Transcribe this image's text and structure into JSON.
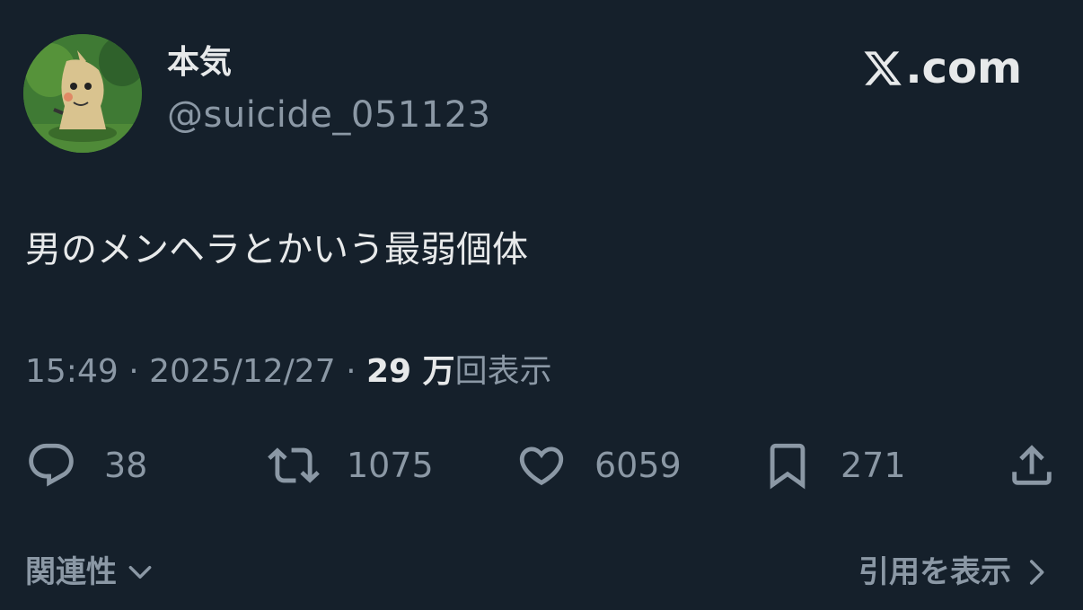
{
  "author": {
    "display_name": "本気",
    "handle": "@suicide_051123",
    "avatar_icon": "mimikyu-avatar-icon"
  },
  "brand": {
    "domain": ".com",
    "logo_icon": "x-logo-icon"
  },
  "tweet": {
    "text": "男のメンヘラとかいう最弱個体",
    "time": "15:49",
    "separator": "·",
    "date": "2025/12/27",
    "views_count": "29 万",
    "views_label": "回表示"
  },
  "actions": {
    "replies": {
      "icon": "reply-icon",
      "count": "38"
    },
    "retweets": {
      "icon": "retweet-icon",
      "count": "1075"
    },
    "likes": {
      "icon": "heart-icon",
      "count": "6059"
    },
    "bookmarks": {
      "icon": "bookmark-icon",
      "count": "271"
    },
    "share": {
      "icon": "share-icon"
    }
  },
  "footer": {
    "related_label": "関連性",
    "quotes_label": "引用を表示"
  },
  "colors": {
    "background": "#15202b",
    "primary_text": "#e7e9ea",
    "secondary_text": "#8b98a5"
  }
}
